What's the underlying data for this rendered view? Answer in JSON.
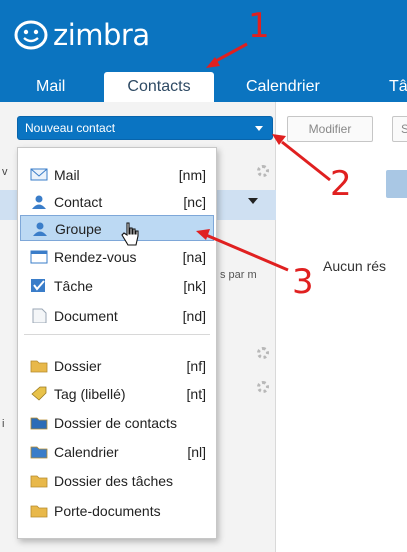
{
  "app": {
    "logo_text": "zimbra"
  },
  "tabs": [
    {
      "label": "Mail",
      "active": false
    },
    {
      "label": "Contacts",
      "active": true
    },
    {
      "label": "Calendrier",
      "active": false
    },
    {
      "label": "Tâ",
      "active": false
    }
  ],
  "toolbar": {
    "new_contact_label": "Nouveau contact",
    "edit_label": "Modifier",
    "next_label": "S"
  },
  "leftpane": {
    "letters": [
      "v",
      "i"
    ],
    "sort_label": "s par m"
  },
  "main": {
    "no_results_text": "Aucun rés"
  },
  "menu": {
    "items": [
      {
        "label": "Mail",
        "shortcut": "[nm]",
        "icon": "mail-icon",
        "color": "#3a7dc9"
      },
      {
        "label": "Contact",
        "shortcut": "[nc]",
        "icon": "contact-icon",
        "color": "#3a7dc9"
      },
      {
        "label": "Groupe",
        "shortcut": "",
        "icon": "group-icon",
        "color": "#3a7dc9",
        "hover": true
      },
      {
        "label": "Rendez-vous",
        "shortcut": "[na]",
        "icon": "calendar-icon",
        "color": "#3a7dc9"
      },
      {
        "label": "Tâche",
        "shortcut": "[nk]",
        "icon": "task-icon",
        "color": "#3a7dc9"
      },
      {
        "label": "Document",
        "shortcut": "[nd]",
        "icon": "document-icon",
        "color": "#9aa6b4"
      },
      {
        "label": "Dossier",
        "shortcut": "[nf]",
        "icon": "folder-icon",
        "color": "#e8b84a"
      },
      {
        "label": "Tag (libellé)",
        "shortcut": "[nt]",
        "icon": "tag-icon",
        "color": "#e8c24a"
      },
      {
        "label": "Dossier de contacts",
        "shortcut": "",
        "icon": "contacts-folder-icon",
        "color": "#2c6cb7"
      },
      {
        "label": "Calendrier",
        "shortcut": "[nl]",
        "icon": "calendar-folder-icon",
        "color": "#3a7dc9"
      },
      {
        "label": "Dossier des tâches",
        "shortcut": "",
        "icon": "task-folder-icon",
        "color": "#e8b84a"
      },
      {
        "label": "Porte-documents",
        "shortcut": "",
        "icon": "briefcase-icon",
        "color": "#e8b84a"
      }
    ]
  },
  "annotations": [
    "1",
    "2",
    "3"
  ],
  "colors": {
    "header_blue": "#0b74c0",
    "annotation_red": "#e02020",
    "menu_hover": "#bcd9f3"
  }
}
